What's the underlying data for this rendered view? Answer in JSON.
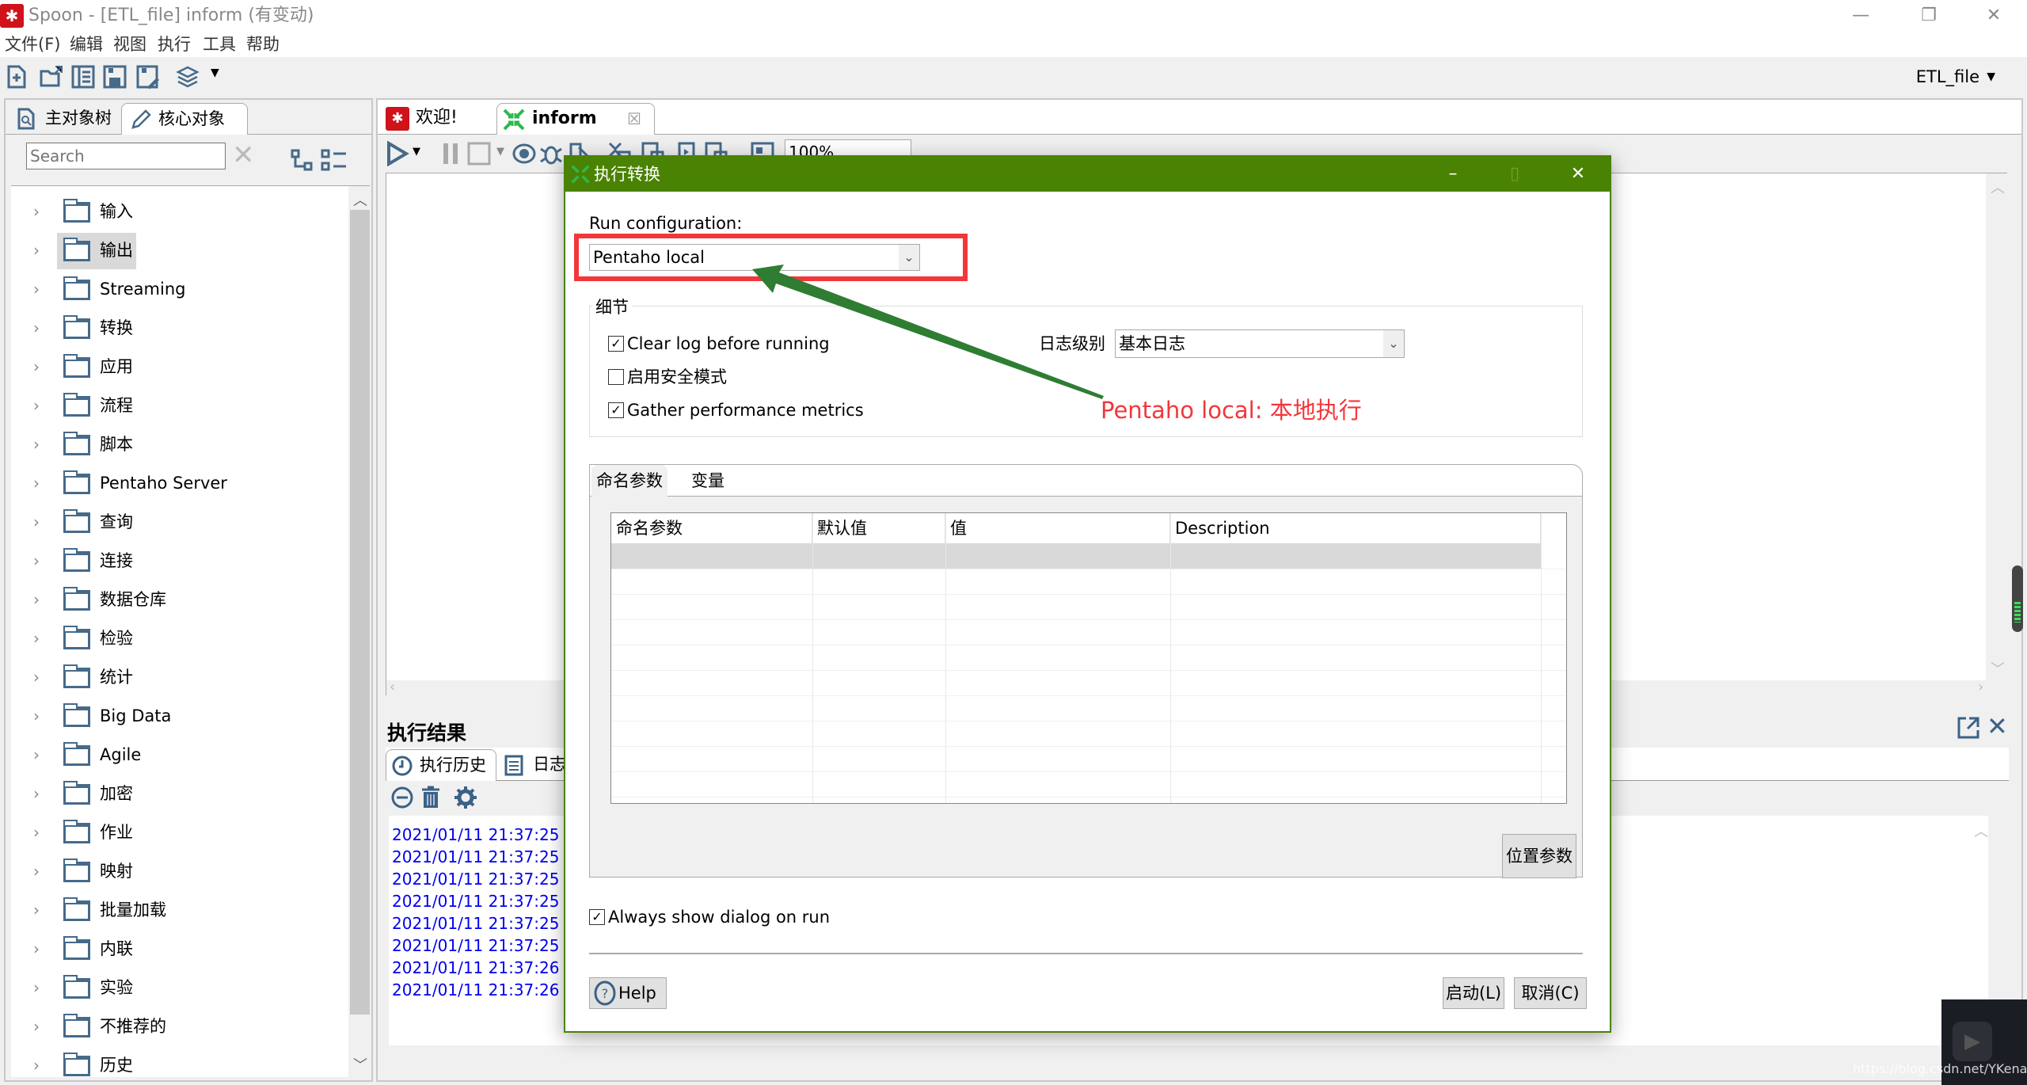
{
  "window": {
    "title": "Spoon - [ETL_file] inform (有变动)",
    "controls": {
      "minimize": "—",
      "restore": "❐",
      "close": "✕"
    }
  },
  "menu": [
    "文件(F)",
    "编辑",
    "视图",
    "执行",
    "工具",
    "帮助"
  ],
  "toolbar": {
    "icons": [
      "new-file-icon",
      "open-file-icon",
      "explore-repository-icon",
      "save-icon",
      "save-as-icon",
      "perspective-layers-icon"
    ],
    "repository_label": "ETL_file"
  },
  "left_panel": {
    "tabs": [
      {
        "label": "主对象树",
        "icon": "search-tree-icon",
        "active": false
      },
      {
        "label": "核心对象",
        "icon": "pencil-icon",
        "active": true
      }
    ],
    "search_placeholder": "Search",
    "tree_items": [
      {
        "label": "输入",
        "selected": false
      },
      {
        "label": "输出",
        "selected": true
      },
      {
        "label": "Streaming",
        "selected": false
      },
      {
        "label": "转换",
        "selected": false
      },
      {
        "label": "应用",
        "selected": false
      },
      {
        "label": "流程",
        "selected": false
      },
      {
        "label": "脚本",
        "selected": false
      },
      {
        "label": "Pentaho Server",
        "selected": false
      },
      {
        "label": "查询",
        "selected": false
      },
      {
        "label": "连接",
        "selected": false
      },
      {
        "label": "数据仓库",
        "selected": false
      },
      {
        "label": "检验",
        "selected": false
      },
      {
        "label": "统计",
        "selected": false
      },
      {
        "label": "Big Data",
        "selected": false
      },
      {
        "label": "Agile",
        "selected": false
      },
      {
        "label": "加密",
        "selected": false
      },
      {
        "label": "作业",
        "selected": false
      },
      {
        "label": "映射",
        "selected": false
      },
      {
        "label": "批量加载",
        "selected": false
      },
      {
        "label": "内联",
        "selected": false
      },
      {
        "label": "实验",
        "selected": false
      },
      {
        "label": "不推荐的",
        "selected": false
      },
      {
        "label": "历史",
        "selected": false
      }
    ]
  },
  "editor": {
    "tabs": [
      {
        "label": "欢迎!",
        "icon": "spoon-welcome-icon",
        "active": false
      },
      {
        "label": "inform",
        "icon": "transformation-icon",
        "active": true,
        "closable": true
      }
    ],
    "zoom_level": "100%",
    "results": {
      "title": "执行结果",
      "tabs": [
        {
          "label": "执行历史",
          "icon": "clock-icon",
          "active": true
        },
        {
          "label": "日志",
          "icon": "log-icon",
          "active": false
        }
      ],
      "log_lines": [
        "2021/01/11 21:37:25 -",
        "2021/01/11 21:37:25 -",
        "2021/01/11 21:37:25 -",
        "2021/01/11 21:37:25 -",
        "2021/01/11 21:37:25 -",
        "2021/01/11 21:37:25 -",
        "2021/01/11 21:37:26 -",
        "2021/01/11 21:37:26 -"
      ]
    }
  },
  "dialog": {
    "title": "执行转换",
    "run_configuration_label": "Run configuration:",
    "run_configuration_value": "Pentaho local",
    "details_legend": "细节",
    "checkboxes": [
      {
        "label": "Clear log before running",
        "checked": true
      },
      {
        "label": "启用安全模式",
        "checked": false
      },
      {
        "label": "Gather performance metrics",
        "checked": true
      }
    ],
    "log_level_label": "日志级别",
    "log_level_value": "基本日志",
    "annotation": "Pentaho local: 本地执行",
    "param_tabs": [
      {
        "label": "命名参数",
        "active": true
      },
      {
        "label": "变量",
        "active": false
      }
    ],
    "param_columns": [
      "命名参数",
      "默认值",
      "值",
      "Description"
    ],
    "position_params_button": "位置参数",
    "always_show_label": "Always show dialog on run",
    "always_show_checked": true,
    "help_button": "Help",
    "start_button": "启动(L)",
    "cancel_button": "取消(C)",
    "colors": {
      "titlebar": "#4a8204",
      "highlight": "#f2373a",
      "arrow": "#2e7d32"
    }
  },
  "watermark": "https://blog.csdn.net/YKenan"
}
